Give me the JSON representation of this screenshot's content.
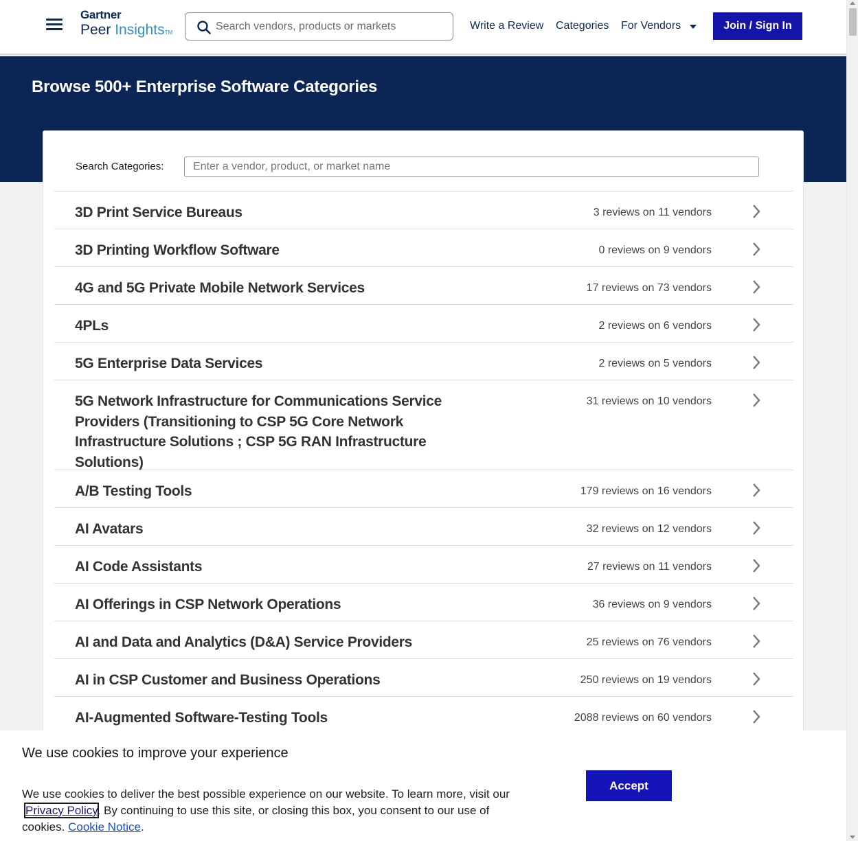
{
  "header": {
    "logo_top": "Gartner",
    "logo_peer": "Peer",
    "logo_insights": "Insights",
    "logo_tm": "TM",
    "search_placeholder": "Search vendors, products or markets",
    "nav": {
      "write_review": "Write a Review",
      "categories": "Categories",
      "for_vendors": "For Vendors"
    },
    "join_label": "Join / Sign In"
  },
  "hero": {
    "title": "Browse 500+ Enterprise Software Categories"
  },
  "categories": {
    "search_label": "Search Categories:",
    "search_placeholder": "Enter a vendor, product, or market name",
    "items": [
      {
        "name": "3D Print Service Bureaus",
        "count": "3 reviews on 11 vendors"
      },
      {
        "name": "3D Printing Workflow Software",
        "count": "0 reviews on 9 vendors"
      },
      {
        "name": "4G and 5G Private Mobile Network Services",
        "count": "17 reviews on 73 vendors"
      },
      {
        "name": "4PLs",
        "count": "2 reviews on 6 vendors"
      },
      {
        "name": "5G Enterprise Data Services",
        "count": "2 reviews on 5 vendors"
      },
      {
        "name": "5G Network Infrastructure for Communications Service Providers (Transitioning to CSP 5G Core Network Infrastructure Solutions ; CSP 5G RAN Infrastructure Solutions)",
        "count": "31 reviews on 10 vendors"
      },
      {
        "name": "A/B Testing Tools",
        "count": "179 reviews on 16 vendors"
      },
      {
        "name": "AI Avatars",
        "count": "32 reviews on 12 vendors"
      },
      {
        "name": "AI Code Assistants",
        "count": "27 reviews on 11 vendors"
      },
      {
        "name": "AI Offerings in CSP Network Operations",
        "count": "36 reviews on 9 vendors"
      },
      {
        "name": "AI and Data and Analytics (D&A) Service Providers",
        "count": "25 reviews on 76 vendors"
      },
      {
        "name": "AI in CSP Customer and Business Operations",
        "count": "250 reviews on 19 vendors"
      },
      {
        "name": "AI-Augmented Software-Testing Tools",
        "count": "2088 reviews on 60 vendors"
      }
    ]
  },
  "cookie": {
    "title": "We use cookies to improve your experience",
    "text_1": "We use cookies to deliver the best possible experience on our website. To learn more, visit our",
    "privacy_link": "Privacy Policy",
    "text_2": ". By continuing to use this site, or closing this box, you consent to our use of cookies.",
    "cookie_notice_link": "Cookie Notice",
    "text_3": ".",
    "accept_label": "Accept"
  },
  "colors": {
    "brand_navy": "#0b2654",
    "button_blue": "#1414a8",
    "link_blue": "#1a4fcc"
  }
}
